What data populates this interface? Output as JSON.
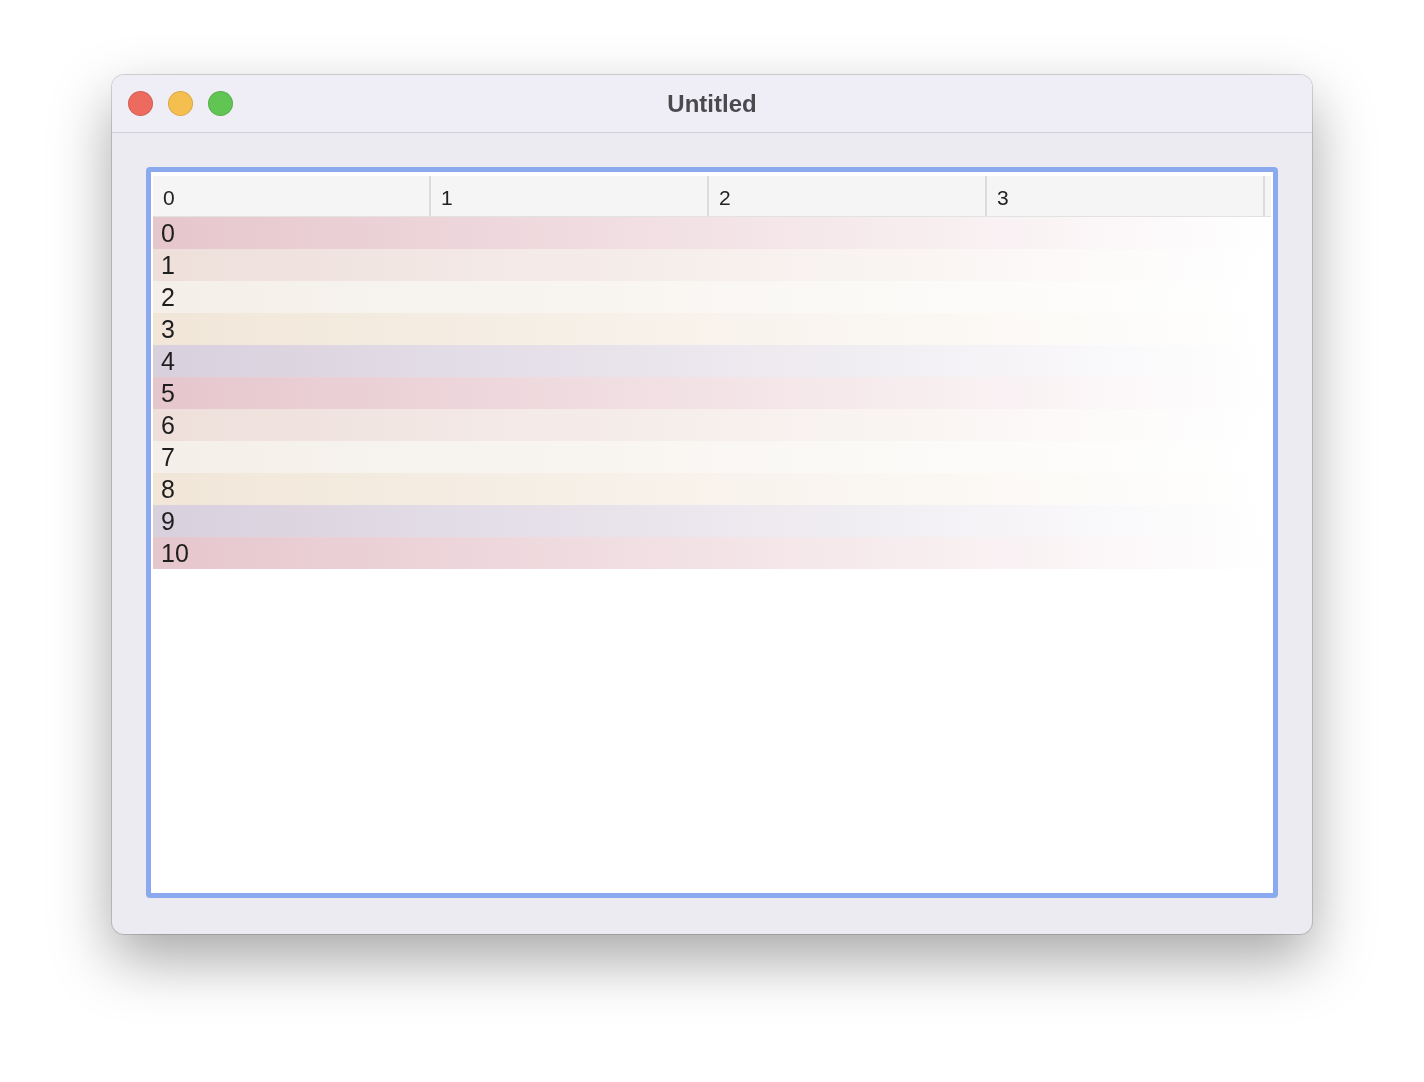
{
  "window": {
    "title": "Untitled"
  },
  "table": {
    "focused": true,
    "columns": [
      "0",
      "1",
      "2",
      "3"
    ],
    "rows": [
      {
        "label": "0",
        "color": "#e6c6cd"
      },
      {
        "label": "1",
        "color": "#eedfda"
      },
      {
        "label": "2",
        "color": "#f4efe8"
      },
      {
        "label": "3",
        "color": "#f1e6d8"
      },
      {
        "label": "4",
        "color": "#d8d0dd"
      },
      {
        "label": "5",
        "color": "#e6c6cd"
      },
      {
        "label": "6",
        "color": "#eedfda"
      },
      {
        "label": "7",
        "color": "#f4efe8"
      },
      {
        "label": "8",
        "color": "#f1e6d8"
      },
      {
        "label": "9",
        "color": "#d8d0dd"
      },
      {
        "label": "10",
        "color": "#e6c6cd"
      }
    ]
  }
}
